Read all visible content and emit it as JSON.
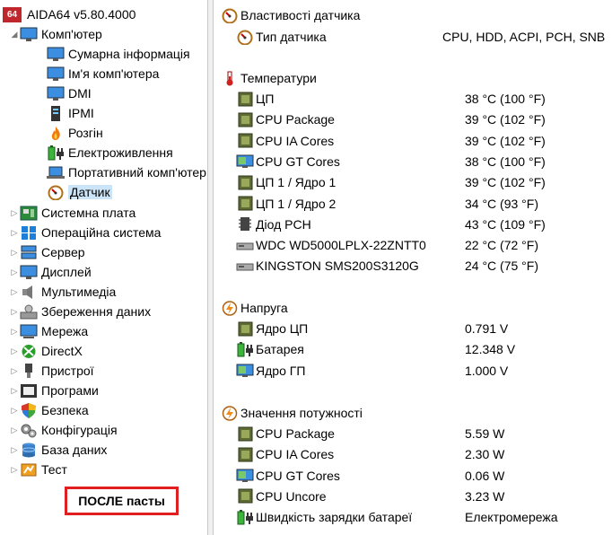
{
  "tree": {
    "root": {
      "badge": "64",
      "label": "AIDA64 v5.80.4000"
    },
    "computer": {
      "label": "Комп'ютер",
      "children": [
        {
          "label": "Сумарна інформація",
          "icon": "monitor-icon"
        },
        {
          "label": "Ім'я комп'ютера",
          "icon": "monitor-icon"
        },
        {
          "label": "DMI",
          "icon": "monitor-icon"
        },
        {
          "label": "IPMI",
          "icon": "server-icon"
        },
        {
          "label": "Розгін",
          "icon": "flame-icon"
        },
        {
          "label": "Електроживлення",
          "icon": "battery-plug-icon"
        },
        {
          "label": "Портативний комп'ютер",
          "icon": "laptop-icon"
        },
        {
          "label": "Датчик",
          "icon": "gauge-icon"
        }
      ]
    },
    "items": [
      {
        "label": "Системна плата",
        "icon": "motherboard-icon"
      },
      {
        "label": "Операційна система",
        "icon": "windows-icon"
      },
      {
        "label": "Сервер",
        "icon": "server-icon"
      },
      {
        "label": "Дисплей",
        "icon": "monitor-icon"
      },
      {
        "label": "Мультимедіа",
        "icon": "speaker-icon"
      },
      {
        "label": "Збереження даних",
        "icon": "storage-icon"
      },
      {
        "label": "Мережа",
        "icon": "network-icon"
      },
      {
        "label": "DirectX",
        "icon": "xbox-icon"
      },
      {
        "label": "Пристрої",
        "icon": "usb-icon"
      },
      {
        "label": "Програми",
        "icon": "programs-icon"
      },
      {
        "label": "Безпека",
        "icon": "shield-icon"
      },
      {
        "label": "Конфігурація",
        "icon": "gears-icon"
      },
      {
        "label": "База даних",
        "icon": "database-icon"
      },
      {
        "label": "Тест",
        "icon": "benchmark-icon"
      }
    ]
  },
  "annotation": "ПОСЛЕ пасты",
  "sensor": {
    "props_header": "Властивості датчика",
    "props": [
      {
        "name": "Тип датчика",
        "value": "CPU, HDD, ACPI, PCH, SNB",
        "icon": "gauge-icon"
      }
    ],
    "temps_header": "Температури",
    "temps": [
      {
        "name": "ЦП",
        "value": "38 °C  (100 °F)",
        "icon": "chip-icon"
      },
      {
        "name": "CPU Package",
        "value": "39 °C  (102 °F)",
        "icon": "chip-icon"
      },
      {
        "name": "CPU IA Cores",
        "value": "39 °C  (102 °F)",
        "icon": "chip-icon"
      },
      {
        "name": "CPU GT Cores",
        "value": "38 °C  (100 °F)",
        "icon": "gpu-icon"
      },
      {
        "name": "ЦП 1 / Ядро 1",
        "value": "39 °C  (102 °F)",
        "icon": "chip-icon"
      },
      {
        "name": "ЦП 1 / Ядро 2",
        "value": "34 °C  (93 °F)",
        "icon": "chip-icon"
      },
      {
        "name": "Діод PCH",
        "value": "43 °C  (109 °F)",
        "icon": "pch-icon"
      },
      {
        "name": "WDC WD5000LPLX-22ZNTT0",
        "value": "22 °C  (72 °F)",
        "icon": "hdd-icon"
      },
      {
        "name": "KINGSTON SMS200S3120G",
        "value": "24 °C  (75 °F)",
        "icon": "hdd-icon"
      }
    ],
    "volt_header": "Напруга",
    "volts": [
      {
        "name": "Ядро ЦП",
        "value": "0.791 V",
        "icon": "chip-icon"
      },
      {
        "name": "Батарея",
        "value": "12.348 V",
        "icon": "battery-plug-icon"
      },
      {
        "name": "Ядро ГП",
        "value": "1.000 V",
        "icon": "gpu-icon"
      }
    ],
    "power_header": "Значення потужності",
    "powers": [
      {
        "name": "CPU Package",
        "value": "5.59 W",
        "icon": "chip-icon"
      },
      {
        "name": "CPU IA Cores",
        "value": "2.30 W",
        "icon": "chip-icon"
      },
      {
        "name": "CPU GT Cores",
        "value": "0.06 W",
        "icon": "gpu-icon"
      },
      {
        "name": "CPU Uncore",
        "value": "3.23 W",
        "icon": "chip-icon"
      },
      {
        "name": "Швидкість зарядки батареї",
        "value": "Електромережа",
        "icon": "battery-plug-icon"
      }
    ]
  }
}
